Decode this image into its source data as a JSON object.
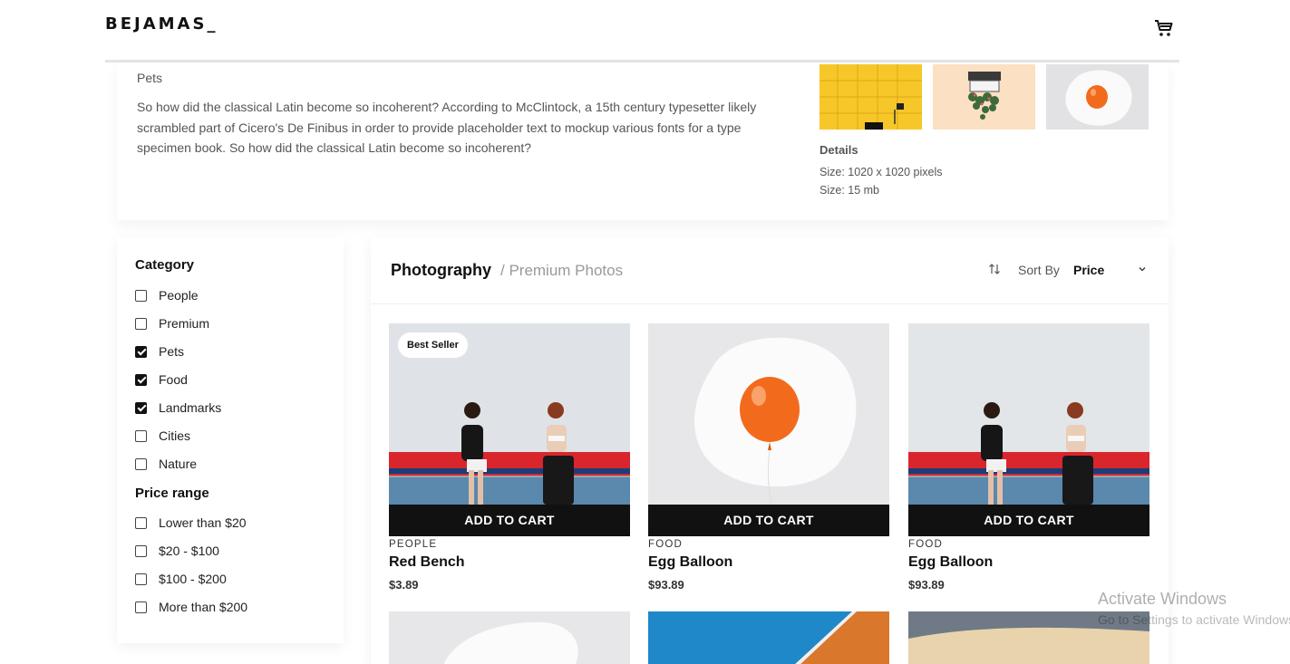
{
  "header": {
    "logo": "BEJAMAS_",
    "cart_icon": "shopping-cart-icon"
  },
  "featured": {
    "category": "Pets",
    "description": "So how did the classical Latin become so incoherent? According to McClintock, a 15th century typesetter likely scrambled part of Cicero's De Finibus in order to provide placeholder text to mockup various fonts for a type specimen book. So how did the classical Latin become so incoherent?",
    "details_title": "Details",
    "size_line": "Size: 1020 x 1020 pixels",
    "filesize_line": "Size: 15 mb"
  },
  "sidebar": {
    "category_heading": "Category",
    "categories": [
      {
        "label": "People",
        "checked": false
      },
      {
        "label": "Premium",
        "checked": false
      },
      {
        "label": "Pets",
        "checked": true
      },
      {
        "label": "Food",
        "checked": true
      },
      {
        "label": "Landmarks",
        "checked": true
      },
      {
        "label": "Cities",
        "checked": false
      },
      {
        "label": "Nature",
        "checked": false
      }
    ],
    "price_heading": "Price range",
    "prices": [
      {
        "label": "Lower than $20",
        "checked": false
      },
      {
        "label": "$20 - $100",
        "checked": false
      },
      {
        "label": "$100 - $200",
        "checked": false
      },
      {
        "label": "More than $200",
        "checked": false
      }
    ]
  },
  "main": {
    "title": "Photography",
    "subtitle": "/ Premium Photos",
    "sort_label": "Sort By",
    "sort_value": "Price",
    "add_to_cart": "ADD TO CART",
    "products": [
      {
        "category": "PEOPLE",
        "name": "Red Bench",
        "price": "$3.89",
        "badge": "Best Seller"
      },
      {
        "category": "FOOD",
        "name": "Egg Balloon",
        "price": "$93.89"
      },
      {
        "category": "FOOD",
        "name": "Egg Balloon",
        "price": "$93.89"
      }
    ]
  },
  "watermark": {
    "title": "Activate Windows",
    "subtitle": "Go to Settings to activate Windows."
  },
  "colors": {
    "accent": "#111111",
    "text_muted": "#555555",
    "balloon": "#f26b1d",
    "bench": "#d8262c",
    "thumb_yellow": "#f7c72a",
    "thumb_peach": "#fbe0c4"
  }
}
